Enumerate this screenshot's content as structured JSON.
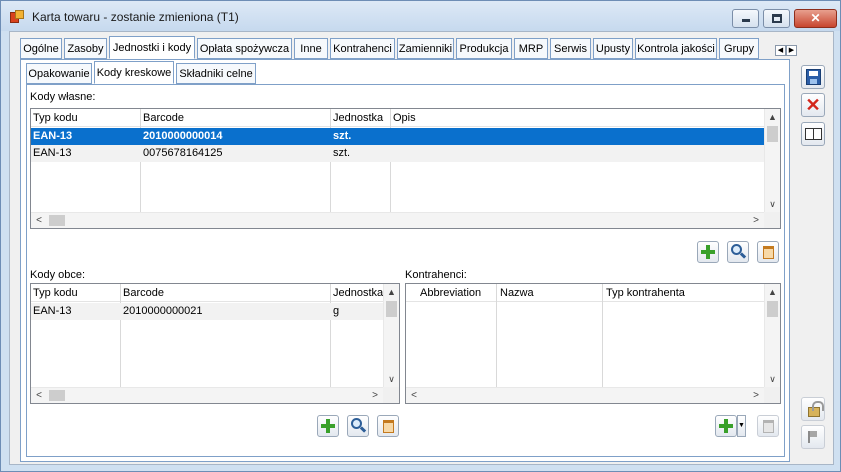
{
  "window": {
    "title": "Karta towaru - zostanie zmieniona (T1)"
  },
  "main_tabs": [
    {
      "label": "Ogólne"
    },
    {
      "label": "Zasoby"
    },
    {
      "label": "Jednostki i kody",
      "active": true
    },
    {
      "label": "Opłata spożywcza"
    },
    {
      "label": "Inne"
    },
    {
      "label": "Kontrahenci"
    },
    {
      "label": "Zamienniki"
    },
    {
      "label": "Produkcja"
    },
    {
      "label": "MRP"
    },
    {
      "label": "Serwis"
    },
    {
      "label": "Upusty"
    },
    {
      "label": "Kontrola jakości"
    },
    {
      "label": "Grupy"
    }
  ],
  "sub_tabs": [
    {
      "label": "Opakowanie"
    },
    {
      "label": "Kody kreskowe",
      "active": true
    },
    {
      "label": "Składniki celne"
    }
  ],
  "kody_wlasne": {
    "label": "Kody własne:",
    "columns": [
      "Typ kodu",
      "Barcode",
      "Jednostka",
      "Opis"
    ],
    "rows": [
      {
        "typ": "EAN-13",
        "barcode": "2010000000014",
        "jednostka": "szt.",
        "opis": "",
        "selected": true
      },
      {
        "typ": "EAN-13",
        "barcode": "0075678164125",
        "jednostka": "szt.",
        "opis": ""
      }
    ]
  },
  "kody_obce": {
    "label": "Kody obce:",
    "columns": [
      "Typ kodu",
      "Barcode",
      "Jednostka"
    ],
    "rows": [
      {
        "typ": "EAN-13",
        "barcode": "2010000000021",
        "jednostka": "g"
      }
    ]
  },
  "kontrahenci": {
    "label": "Kontrahenci:",
    "columns": [
      "Abbreviation",
      "Nazwa",
      "Typ kontrahenta"
    ],
    "rows": []
  },
  "icons": {
    "add": "plus-icon",
    "search": "magnifier-icon",
    "delete": "trash-icon",
    "save": "save-icon",
    "cancel": "close-icon",
    "help": "book-icon",
    "lock": "lock-icon",
    "flag": "flag-icon"
  }
}
